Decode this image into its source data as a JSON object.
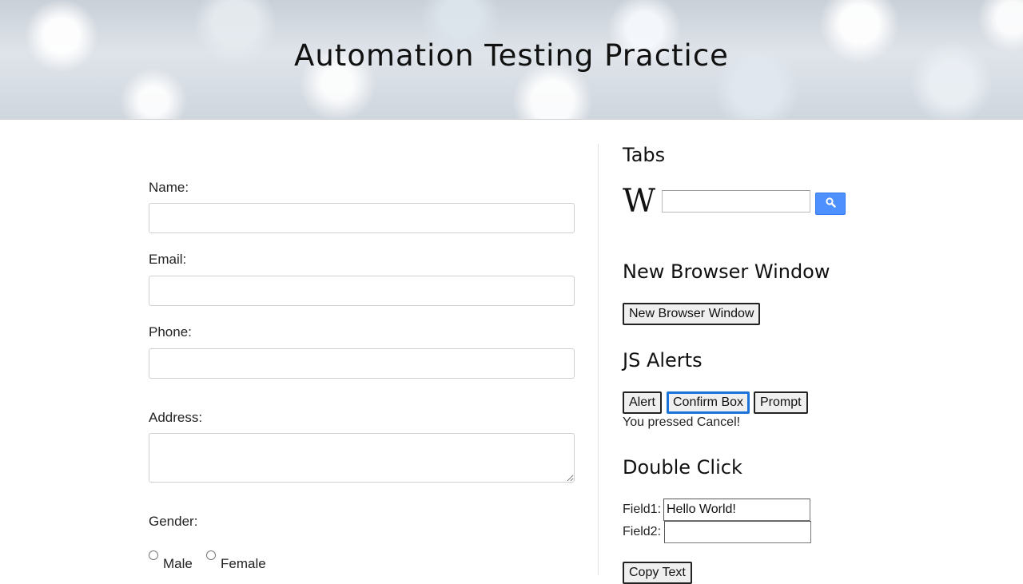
{
  "header": {
    "title": "Automation Testing Practice"
  },
  "form": {
    "name_label": "Name:",
    "email_label": "Email:",
    "phone_label": "Phone:",
    "address_label": "Address:",
    "gender_label": "Gender:",
    "gender_options": [
      "Male",
      "Female"
    ],
    "name_value": "",
    "email_value": "",
    "phone_value": "",
    "address_value": ""
  },
  "tabs": {
    "heading": "Tabs",
    "wiki_logo": "W",
    "search_value": "",
    "search_icon": "search-icon",
    "search_button_color": "#4d90fe"
  },
  "new_window": {
    "heading": "New Browser Window",
    "button_label": "New Browser Window"
  },
  "js_alerts": {
    "heading": "JS Alerts",
    "buttons": [
      "Alert",
      "Confirm Box",
      "Prompt"
    ],
    "result": "You pressed Cancel!",
    "focus_color": "#1a73d9"
  },
  "double_click": {
    "heading": "Double Click",
    "field1_label": "Field1:",
    "field1_value": "Hello World!",
    "field2_label": "Field2:",
    "field2_value": "",
    "copy_button_label": "Copy Text"
  }
}
